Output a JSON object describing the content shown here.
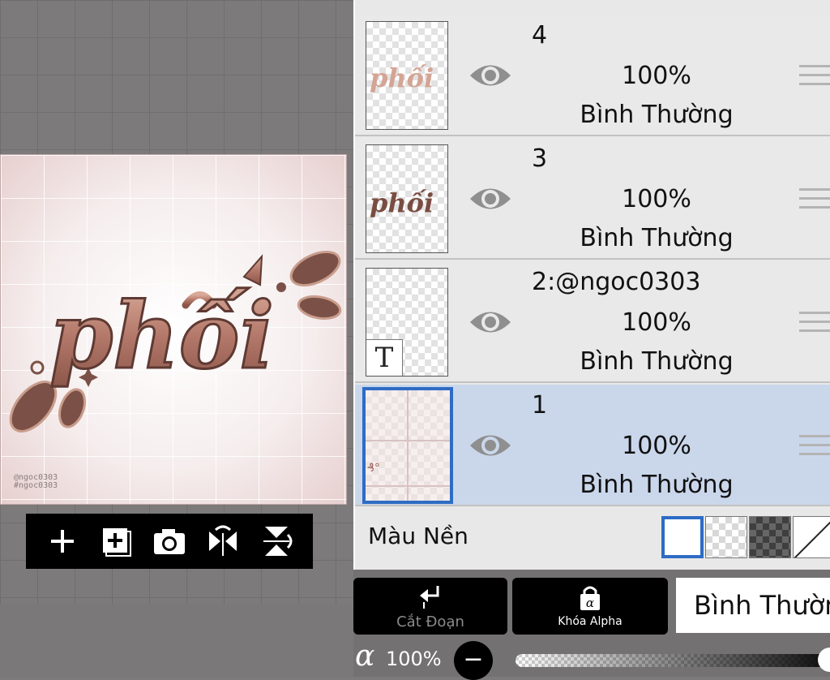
{
  "canvas": {
    "artwork_text": "phối",
    "watermark_line1": "@ngoc0303",
    "watermark_line2": "#ngoc0303"
  },
  "toolbar": {
    "tools": [
      {
        "icon": "add-layer-icon"
      },
      {
        "icon": "add-image-layer-icon"
      },
      {
        "icon": "camera-icon"
      },
      {
        "icon": "flip-horizontal-icon"
      },
      {
        "icon": "flip-vertical-icon"
      }
    ]
  },
  "layers": [
    {
      "name": "4",
      "opacity": "100%",
      "blend": "Bình Thường",
      "visible": true,
      "selected": false
    },
    {
      "name": "3",
      "opacity": "100%",
      "blend": "Bình Thường",
      "visible": true,
      "selected": false
    },
    {
      "name": "2:@ngoc0303",
      "opacity": "100%",
      "blend": "Bình Thường",
      "visible": true,
      "selected": false,
      "text_layer_marker": "T"
    },
    {
      "name": "1",
      "opacity": "100%",
      "blend": "Bình Thường",
      "visible": true,
      "selected": true
    }
  ],
  "background": {
    "label": "Màu Nền",
    "options": [
      "white",
      "checker-light",
      "checker-dark",
      "none"
    ],
    "selected": "white"
  },
  "bottom": {
    "clip_label": "Cắt Đoạn",
    "alpha_lock_label": "Khóa Alpha",
    "blend_mode": "Bình Thường",
    "alpha_symbol": "α",
    "opacity_value": "100%",
    "minus_label": "−",
    "opacity_level": 1.0
  },
  "colors": {
    "selection_blue": "#2e6cc4",
    "selected_row": "#cad7eb",
    "panel_bg": "#e8e8e8",
    "artwork_rose": "#b98474"
  }
}
